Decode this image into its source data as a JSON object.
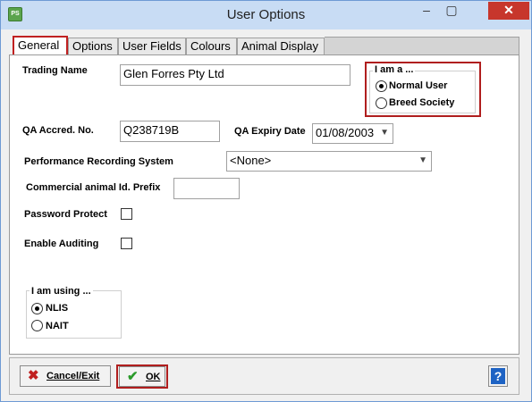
{
  "window": {
    "title": "User Options",
    "app_icon_text": "PS"
  },
  "tabs": [
    {
      "label": "General",
      "active": true
    },
    {
      "label": "Options"
    },
    {
      "label": "User Fields"
    },
    {
      "label": "Colours"
    },
    {
      "label": "Animal Display"
    }
  ],
  "general": {
    "trading_name_label": "Trading Name",
    "trading_name_value": "Glen Forres Pty Ltd",
    "iam_title": "I am a ...",
    "iam_options": [
      {
        "label": "Normal User",
        "selected": true
      },
      {
        "label": "Breed Society",
        "selected": false
      }
    ],
    "qa_accred_label": "QA Accred. No.",
    "qa_accred_value": "Q238719B",
    "qa_expiry_label": "QA Expiry Date",
    "qa_expiry_value": "01/08/2003",
    "perf_label": "Performance Recording System",
    "perf_value": "<None>",
    "prefix_label": "Commercial animal Id. Prefix",
    "prefix_value": "",
    "password_label": "Password Protect",
    "password_checked": false,
    "auditing_label": "Enable Auditing",
    "auditing_checked": false,
    "iusing_title": "I am using ...",
    "iusing_options": [
      {
        "label": "NLIS",
        "selected": true
      },
      {
        "label": "NAIT",
        "selected": false
      }
    ]
  },
  "buttons": {
    "cancel_label": "Cancel/Exit",
    "ok_label": "OK",
    "help_label": "?"
  },
  "colors": {
    "highlight": "#b01e1e",
    "close": "#c7362c",
    "titlebar": "#c8dcf4"
  }
}
